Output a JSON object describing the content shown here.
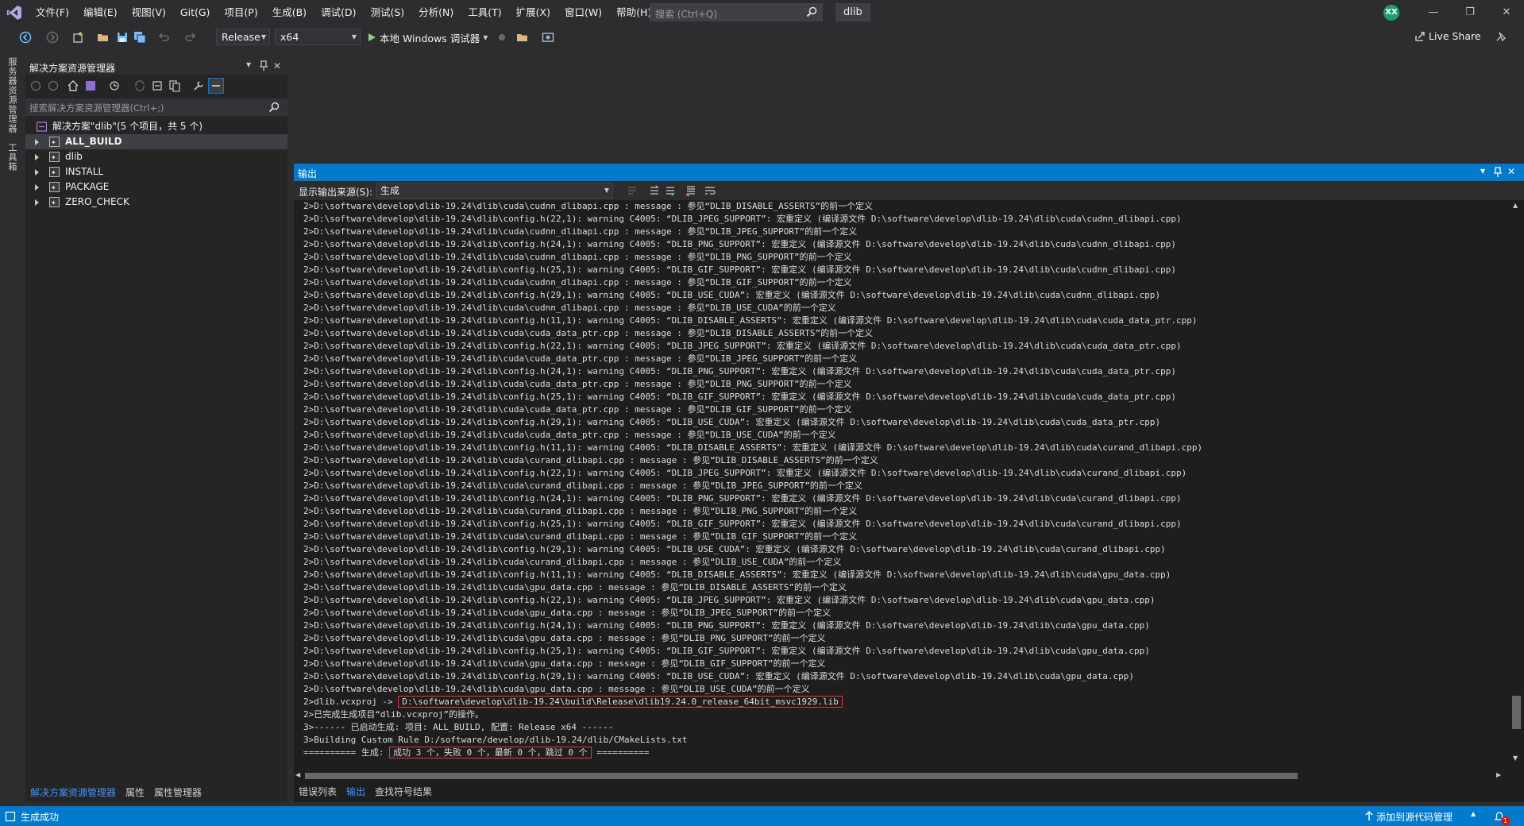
{
  "titlebar": {
    "menu": [
      "文件(F)",
      "编辑(E)",
      "视图(V)",
      "Git(G)",
      "项目(P)",
      "生成(B)",
      "调试(D)",
      "测试(S)",
      "分析(N)",
      "工具(T)",
      "扩展(X)",
      "窗口(W)",
      "帮助(H)"
    ],
    "search_placeholder": "搜索 (Ctrl+Q)",
    "solution_name": "dlib",
    "avatar_initials": "XX"
  },
  "toolbar": {
    "config": "Release",
    "platform": "x64",
    "run_label": "本地 Windows 调试器",
    "live_share": "Live Share"
  },
  "vertical_tabs": [
    "服务器资源管理器",
    "工具箱"
  ],
  "solution_explorer": {
    "title": "解决方案资源管理器",
    "search_placeholder": "搜索解决方案资源管理器(Ctrl+;)",
    "root": "解决方案\"dlib\"(5 个项目，共 5 个)",
    "projects": [
      "ALL_BUILD",
      "dlib",
      "INSTALL",
      "PACKAGE",
      "ZERO_CHECK"
    ],
    "selected_project": "ALL_BUILD",
    "bottom_tabs": [
      "解决方案资源管理器",
      "属性",
      "属性管理器"
    ]
  },
  "output": {
    "title": "输出",
    "source_label": "显示输出来源(S):",
    "source_value": "生成",
    "lines": [
      "2>D:\\software\\develop\\dlib-19.24\\dlib\\cuda\\cudnn_dlibapi.cpp : message : 参见“DLIB_DISABLE_ASSERTS”的前一个定义",
      "2>D:\\software\\develop\\dlib-19.24\\dlib\\config.h(22,1): warning C4005: “DLIB_JPEG_SUPPORT”: 宏重定义 (编译源文件 D:\\software\\develop\\dlib-19.24\\dlib\\cuda\\cudnn_dlibapi.cpp)",
      "2>D:\\software\\develop\\dlib-19.24\\dlib\\cuda\\cudnn_dlibapi.cpp : message : 参见“DLIB_JPEG_SUPPORT”的前一个定义",
      "2>D:\\software\\develop\\dlib-19.24\\dlib\\config.h(24,1): warning C4005: “DLIB_PNG_SUPPORT”: 宏重定义 (编译源文件 D:\\software\\develop\\dlib-19.24\\dlib\\cuda\\cudnn_dlibapi.cpp)",
      "2>D:\\software\\develop\\dlib-19.24\\dlib\\cuda\\cudnn_dlibapi.cpp : message : 参见“DLIB_PNG_SUPPORT”的前一个定义",
      "2>D:\\software\\develop\\dlib-19.24\\dlib\\config.h(25,1): warning C4005: “DLIB_GIF_SUPPORT”: 宏重定义 (编译源文件 D:\\software\\develop\\dlib-19.24\\dlib\\cuda\\cudnn_dlibapi.cpp)",
      "2>D:\\software\\develop\\dlib-19.24\\dlib\\cuda\\cudnn_dlibapi.cpp : message : 参见“DLIB_GIF_SUPPORT”的前一个定义",
      "2>D:\\software\\develop\\dlib-19.24\\dlib\\config.h(29,1): warning C4005: “DLIB_USE_CUDA”: 宏重定义 (编译源文件 D:\\software\\develop\\dlib-19.24\\dlib\\cuda\\cudnn_dlibapi.cpp)",
      "2>D:\\software\\develop\\dlib-19.24\\dlib\\cuda\\cudnn_dlibapi.cpp : message : 参见“DLIB_USE_CUDA”的前一个定义",
      "2>D:\\software\\develop\\dlib-19.24\\dlib\\config.h(11,1): warning C4005: “DLIB_DISABLE_ASSERTS”: 宏重定义 (编译源文件 D:\\software\\develop\\dlib-19.24\\dlib\\cuda\\cuda_data_ptr.cpp)",
      "2>D:\\software\\develop\\dlib-19.24\\dlib\\cuda\\cuda_data_ptr.cpp : message : 参见“DLIB_DISABLE_ASSERTS”的前一个定义",
      "2>D:\\software\\develop\\dlib-19.24\\dlib\\config.h(22,1): warning C4005: “DLIB_JPEG_SUPPORT”: 宏重定义 (编译源文件 D:\\software\\develop\\dlib-19.24\\dlib\\cuda\\cuda_data_ptr.cpp)",
      "2>D:\\software\\develop\\dlib-19.24\\dlib\\cuda\\cuda_data_ptr.cpp : message : 参见“DLIB_JPEG_SUPPORT”的前一个定义",
      "2>D:\\software\\develop\\dlib-19.24\\dlib\\config.h(24,1): warning C4005: “DLIB_PNG_SUPPORT”: 宏重定义 (编译源文件 D:\\software\\develop\\dlib-19.24\\dlib\\cuda\\cuda_data_ptr.cpp)",
      "2>D:\\software\\develop\\dlib-19.24\\dlib\\cuda\\cuda_data_ptr.cpp : message : 参见“DLIB_PNG_SUPPORT”的前一个定义",
      "2>D:\\software\\develop\\dlib-19.24\\dlib\\config.h(25,1): warning C4005: “DLIB_GIF_SUPPORT”: 宏重定义 (编译源文件 D:\\software\\develop\\dlib-19.24\\dlib\\cuda\\cuda_data_ptr.cpp)",
      "2>D:\\software\\develop\\dlib-19.24\\dlib\\cuda\\cuda_data_ptr.cpp : message : 参见“DLIB_GIF_SUPPORT”的前一个定义",
      "2>D:\\software\\develop\\dlib-19.24\\dlib\\config.h(29,1): warning C4005: “DLIB_USE_CUDA”: 宏重定义 (编译源文件 D:\\software\\develop\\dlib-19.24\\dlib\\cuda\\cuda_data_ptr.cpp)",
      "2>D:\\software\\develop\\dlib-19.24\\dlib\\cuda\\cuda_data_ptr.cpp : message : 参见“DLIB_USE_CUDA”的前一个定义",
      "2>D:\\software\\develop\\dlib-19.24\\dlib\\config.h(11,1): warning C4005: “DLIB_DISABLE_ASSERTS”: 宏重定义 (编译源文件 D:\\software\\develop\\dlib-19.24\\dlib\\cuda\\curand_dlibapi.cpp)",
      "2>D:\\software\\develop\\dlib-19.24\\dlib\\cuda\\curand_dlibapi.cpp : message : 参见“DLIB_DISABLE_ASSERTS”的前一个定义",
      "2>D:\\software\\develop\\dlib-19.24\\dlib\\config.h(22,1): warning C4005: “DLIB_JPEG_SUPPORT”: 宏重定义 (编译源文件 D:\\software\\develop\\dlib-19.24\\dlib\\cuda\\curand_dlibapi.cpp)",
      "2>D:\\software\\develop\\dlib-19.24\\dlib\\cuda\\curand_dlibapi.cpp : message : 参见“DLIB_JPEG_SUPPORT”的前一个定义",
      "2>D:\\software\\develop\\dlib-19.24\\dlib\\config.h(24,1): warning C4005: “DLIB_PNG_SUPPORT”: 宏重定义 (编译源文件 D:\\software\\develop\\dlib-19.24\\dlib\\cuda\\curand_dlibapi.cpp)",
      "2>D:\\software\\develop\\dlib-19.24\\dlib\\cuda\\curand_dlibapi.cpp : message : 参见“DLIB_PNG_SUPPORT”的前一个定义",
      "2>D:\\software\\develop\\dlib-19.24\\dlib\\config.h(25,1): warning C4005: “DLIB_GIF_SUPPORT”: 宏重定义 (编译源文件 D:\\software\\develop\\dlib-19.24\\dlib\\cuda\\curand_dlibapi.cpp)",
      "2>D:\\software\\develop\\dlib-19.24\\dlib\\cuda\\curand_dlibapi.cpp : message : 参见“DLIB_GIF_SUPPORT”的前一个定义",
      "2>D:\\software\\develop\\dlib-19.24\\dlib\\config.h(29,1): warning C4005: “DLIB_USE_CUDA”: 宏重定义 (编译源文件 D:\\software\\develop\\dlib-19.24\\dlib\\cuda\\curand_dlibapi.cpp)",
      "2>D:\\software\\develop\\dlib-19.24\\dlib\\cuda\\curand_dlibapi.cpp : message : 参见“DLIB_USE_CUDA”的前一个定义",
      "2>D:\\software\\develop\\dlib-19.24\\dlib\\config.h(11,1): warning C4005: “DLIB_DISABLE_ASSERTS”: 宏重定义 (编译源文件 D:\\software\\develop\\dlib-19.24\\dlib\\cuda\\gpu_data.cpp)",
      "2>D:\\software\\develop\\dlib-19.24\\dlib\\cuda\\gpu_data.cpp : message : 参见“DLIB_DISABLE_ASSERTS”的前一个定义",
      "2>D:\\software\\develop\\dlib-19.24\\dlib\\config.h(22,1): warning C4005: “DLIB_JPEG_SUPPORT”: 宏重定义 (编译源文件 D:\\software\\develop\\dlib-19.24\\dlib\\cuda\\gpu_data.cpp)",
      "2>D:\\software\\develop\\dlib-19.24\\dlib\\cuda\\gpu_data.cpp : message : 参见“DLIB_JPEG_SUPPORT”的前一个定义",
      "2>D:\\software\\develop\\dlib-19.24\\dlib\\config.h(24,1): warning C4005: “DLIB_PNG_SUPPORT”: 宏重定义 (编译源文件 D:\\software\\develop\\dlib-19.24\\dlib\\cuda\\gpu_data.cpp)",
      "2>D:\\software\\develop\\dlib-19.24\\dlib\\cuda\\gpu_data.cpp : message : 参见“DLIB_PNG_SUPPORT”的前一个定义",
      "2>D:\\software\\develop\\dlib-19.24\\dlib\\config.h(25,1): warning C4005: “DLIB_GIF_SUPPORT”: 宏重定义 (编译源文件 D:\\software\\develop\\dlib-19.24\\dlib\\cuda\\gpu_data.cpp)",
      "2>D:\\software\\develop\\dlib-19.24\\dlib\\cuda\\gpu_data.cpp : message : 参见“DLIB_GIF_SUPPORT”的前一个定义",
      "2>D:\\software\\develop\\dlib-19.24\\dlib\\config.h(29,1): warning C4005: “DLIB_USE_CUDA”: 宏重定义 (编译源文件 D:\\software\\develop\\dlib-19.24\\dlib\\cuda\\gpu_data.cpp)",
      "2>D:\\software\\develop\\dlib-19.24\\dlib\\cuda\\gpu_data.cpp : message : 参见“DLIB_USE_CUDA”的前一个定义"
    ],
    "lib_prefix": "2>dlib.vcxproj -> ",
    "lib_path": "D:\\software\\develop\\dlib-19.24\\build\\Release\\dlib19.24.0_release_64bit_msvc1929.lib",
    "done_line": "2>已完成生成项目“dlib.vcxproj”的操作。",
    "start_line": "3>------ 已启动生成: 项目: ALL_BUILD, 配置: Release x64 ------",
    "custom_rule_line": "3>Building Custom Rule D:/software/develop/dlib-19.24/dlib/CMakeLists.txt",
    "summary_prefix": "========== 生成: ",
    "summary_result": "成功 3 个，失败 0 个，最新 0 个，跳过 0 个",
    "summary_suffix": " ==========",
    "bottom_tabs": [
      "错误列表",
      "输出",
      "查找符号结果"
    ],
    "active_tab": "输出"
  },
  "statusbar": {
    "status": "生成成功",
    "source_control": "添加到源代码管理",
    "notifications": "1"
  },
  "colors": {
    "accent": "#007acc",
    "highlight_box": "#e53935",
    "background": "#1e1e1e"
  }
}
